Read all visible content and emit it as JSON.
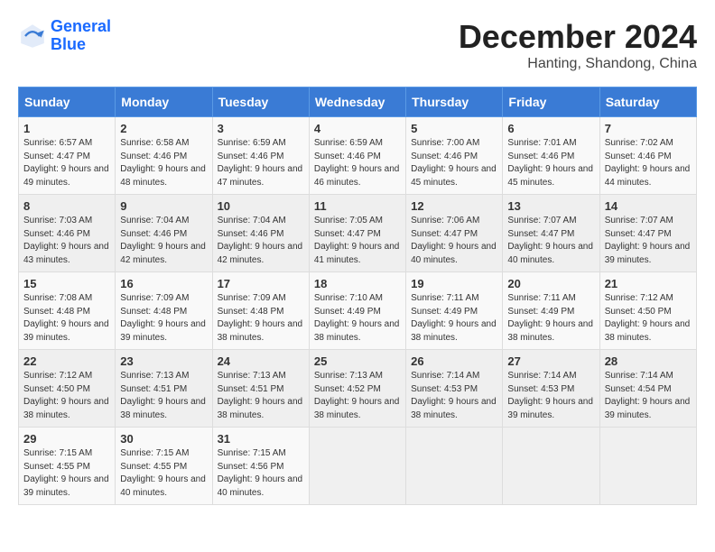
{
  "logo": {
    "line1": "General",
    "line2": "Blue"
  },
  "title": "December 2024",
  "subtitle": "Hanting, Shandong, China",
  "weekdays": [
    "Sunday",
    "Monday",
    "Tuesday",
    "Wednesday",
    "Thursday",
    "Friday",
    "Saturday"
  ],
  "weeks": [
    [
      {
        "day": "1",
        "sunrise": "Sunrise: 6:57 AM",
        "sunset": "Sunset: 4:47 PM",
        "daylight": "Daylight: 9 hours and 49 minutes."
      },
      {
        "day": "2",
        "sunrise": "Sunrise: 6:58 AM",
        "sunset": "Sunset: 4:46 PM",
        "daylight": "Daylight: 9 hours and 48 minutes."
      },
      {
        "day": "3",
        "sunrise": "Sunrise: 6:59 AM",
        "sunset": "Sunset: 4:46 PM",
        "daylight": "Daylight: 9 hours and 47 minutes."
      },
      {
        "day": "4",
        "sunrise": "Sunrise: 6:59 AM",
        "sunset": "Sunset: 4:46 PM",
        "daylight": "Daylight: 9 hours and 46 minutes."
      },
      {
        "day": "5",
        "sunrise": "Sunrise: 7:00 AM",
        "sunset": "Sunset: 4:46 PM",
        "daylight": "Daylight: 9 hours and 45 minutes."
      },
      {
        "day": "6",
        "sunrise": "Sunrise: 7:01 AM",
        "sunset": "Sunset: 4:46 PM",
        "daylight": "Daylight: 9 hours and 45 minutes."
      },
      {
        "day": "7",
        "sunrise": "Sunrise: 7:02 AM",
        "sunset": "Sunset: 4:46 PM",
        "daylight": "Daylight: 9 hours and 44 minutes."
      }
    ],
    [
      {
        "day": "8",
        "sunrise": "Sunrise: 7:03 AM",
        "sunset": "Sunset: 4:46 PM",
        "daylight": "Daylight: 9 hours and 43 minutes."
      },
      {
        "day": "9",
        "sunrise": "Sunrise: 7:04 AM",
        "sunset": "Sunset: 4:46 PM",
        "daylight": "Daylight: 9 hours and 42 minutes."
      },
      {
        "day": "10",
        "sunrise": "Sunrise: 7:04 AM",
        "sunset": "Sunset: 4:46 PM",
        "daylight": "Daylight: 9 hours and 42 minutes."
      },
      {
        "day": "11",
        "sunrise": "Sunrise: 7:05 AM",
        "sunset": "Sunset: 4:47 PM",
        "daylight": "Daylight: 9 hours and 41 minutes."
      },
      {
        "day": "12",
        "sunrise": "Sunrise: 7:06 AM",
        "sunset": "Sunset: 4:47 PM",
        "daylight": "Daylight: 9 hours and 40 minutes."
      },
      {
        "day": "13",
        "sunrise": "Sunrise: 7:07 AM",
        "sunset": "Sunset: 4:47 PM",
        "daylight": "Daylight: 9 hours and 40 minutes."
      },
      {
        "day": "14",
        "sunrise": "Sunrise: 7:07 AM",
        "sunset": "Sunset: 4:47 PM",
        "daylight": "Daylight: 9 hours and 39 minutes."
      }
    ],
    [
      {
        "day": "15",
        "sunrise": "Sunrise: 7:08 AM",
        "sunset": "Sunset: 4:48 PM",
        "daylight": "Daylight: 9 hours and 39 minutes."
      },
      {
        "day": "16",
        "sunrise": "Sunrise: 7:09 AM",
        "sunset": "Sunset: 4:48 PM",
        "daylight": "Daylight: 9 hours and 39 minutes."
      },
      {
        "day": "17",
        "sunrise": "Sunrise: 7:09 AM",
        "sunset": "Sunset: 4:48 PM",
        "daylight": "Daylight: 9 hours and 38 minutes."
      },
      {
        "day": "18",
        "sunrise": "Sunrise: 7:10 AM",
        "sunset": "Sunset: 4:49 PM",
        "daylight": "Daylight: 9 hours and 38 minutes."
      },
      {
        "day": "19",
        "sunrise": "Sunrise: 7:11 AM",
        "sunset": "Sunset: 4:49 PM",
        "daylight": "Daylight: 9 hours and 38 minutes."
      },
      {
        "day": "20",
        "sunrise": "Sunrise: 7:11 AM",
        "sunset": "Sunset: 4:49 PM",
        "daylight": "Daylight: 9 hours and 38 minutes."
      },
      {
        "day": "21",
        "sunrise": "Sunrise: 7:12 AM",
        "sunset": "Sunset: 4:50 PM",
        "daylight": "Daylight: 9 hours and 38 minutes."
      }
    ],
    [
      {
        "day": "22",
        "sunrise": "Sunrise: 7:12 AM",
        "sunset": "Sunset: 4:50 PM",
        "daylight": "Daylight: 9 hours and 38 minutes."
      },
      {
        "day": "23",
        "sunrise": "Sunrise: 7:13 AM",
        "sunset": "Sunset: 4:51 PM",
        "daylight": "Daylight: 9 hours and 38 minutes."
      },
      {
        "day": "24",
        "sunrise": "Sunrise: 7:13 AM",
        "sunset": "Sunset: 4:51 PM",
        "daylight": "Daylight: 9 hours and 38 minutes."
      },
      {
        "day": "25",
        "sunrise": "Sunrise: 7:13 AM",
        "sunset": "Sunset: 4:52 PM",
        "daylight": "Daylight: 9 hours and 38 minutes."
      },
      {
        "day": "26",
        "sunrise": "Sunrise: 7:14 AM",
        "sunset": "Sunset: 4:53 PM",
        "daylight": "Daylight: 9 hours and 38 minutes."
      },
      {
        "day": "27",
        "sunrise": "Sunrise: 7:14 AM",
        "sunset": "Sunset: 4:53 PM",
        "daylight": "Daylight: 9 hours and 39 minutes."
      },
      {
        "day": "28",
        "sunrise": "Sunrise: 7:14 AM",
        "sunset": "Sunset: 4:54 PM",
        "daylight": "Daylight: 9 hours and 39 minutes."
      }
    ],
    [
      {
        "day": "29",
        "sunrise": "Sunrise: 7:15 AM",
        "sunset": "Sunset: 4:55 PM",
        "daylight": "Daylight: 9 hours and 39 minutes."
      },
      {
        "day": "30",
        "sunrise": "Sunrise: 7:15 AM",
        "sunset": "Sunset: 4:55 PM",
        "daylight": "Daylight: 9 hours and 40 minutes."
      },
      {
        "day": "31",
        "sunrise": "Sunrise: 7:15 AM",
        "sunset": "Sunset: 4:56 PM",
        "daylight": "Daylight: 9 hours and 40 minutes."
      },
      null,
      null,
      null,
      null
    ]
  ]
}
